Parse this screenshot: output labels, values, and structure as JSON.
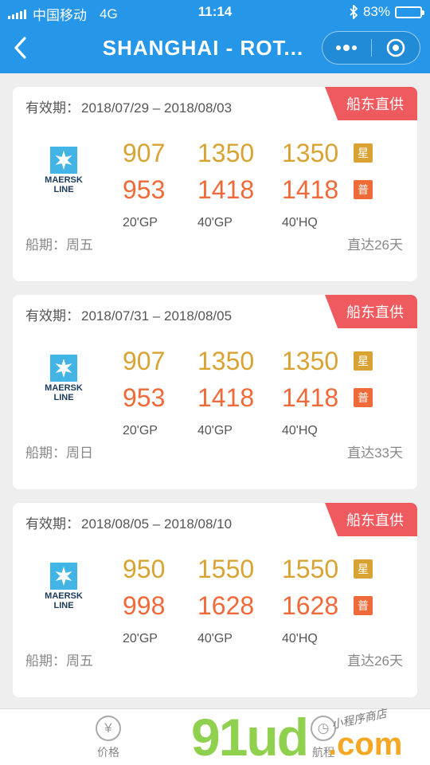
{
  "status_bar": {
    "carrier": "中国移动",
    "network": "4G",
    "time": "11:14",
    "battery_percent": "83%",
    "battery_level": 0.83,
    "bluetooth_icon": "bluetooth-icon"
  },
  "nav": {
    "title": "SHANGHAI - ROT...",
    "back_icon": "chevron-left-icon",
    "more_icon": "more-dots-icon",
    "close_icon": "target-circle-icon"
  },
  "colors": {
    "header_bg": "#2596e8",
    "star_price": "#d9a334",
    "normal_price": "#ef6a38",
    "tag_bg": "#ef5a5f"
  },
  "cards": [
    {
      "validity_label": "有效期：",
      "validity": "2018/07/29 – 2018/08/03",
      "tag": "船东直供",
      "carrier_logo_line1": "MAERSK",
      "carrier_logo_line2": "LINE",
      "star_prices": [
        "907",
        "1350",
        "1350"
      ],
      "normal_prices": [
        "953",
        "1418",
        "1418"
      ],
      "star_badge": "星",
      "normal_badge": "普",
      "container_types": [
        "20'GP",
        "40'GP",
        "40'HQ"
      ],
      "sailing": "船期：周五",
      "transit": "直达26天"
    },
    {
      "validity_label": "有效期：",
      "validity": "2018/07/31 – 2018/08/05",
      "tag": "船东直供",
      "carrier_logo_line1": "MAERSK",
      "carrier_logo_line2": "LINE",
      "star_prices": [
        "907",
        "1350",
        "1350"
      ],
      "normal_prices": [
        "953",
        "1418",
        "1418"
      ],
      "star_badge": "星",
      "normal_badge": "普",
      "container_types": [
        "20'GP",
        "40'GP",
        "40'HQ"
      ],
      "sailing": "船期：周日",
      "transit": "直达33天"
    },
    {
      "validity_label": "有效期：",
      "validity": "2018/08/05 – 2018/08/10",
      "tag": "船东直供",
      "carrier_logo_line1": "MAERSK",
      "carrier_logo_line2": "LINE",
      "star_prices": [
        "950",
        "1550",
        "1550"
      ],
      "normal_prices": [
        "998",
        "1628",
        "1628"
      ],
      "star_badge": "星",
      "normal_badge": "普",
      "container_types": [
        "20'GP",
        "40'GP",
        "40'HQ"
      ],
      "sailing": "船期：周五",
      "transit": "直达26天"
    }
  ],
  "tabbar": {
    "tabs": [
      {
        "label": "价格",
        "icon": "yen-icon",
        "glyph": "¥"
      },
      {
        "label": "航程",
        "icon": "clock-icon",
        "glyph": "◷"
      }
    ]
  },
  "watermark": {
    "main": "91ud",
    "suffix": ".com",
    "sub": "小程序商店"
  }
}
